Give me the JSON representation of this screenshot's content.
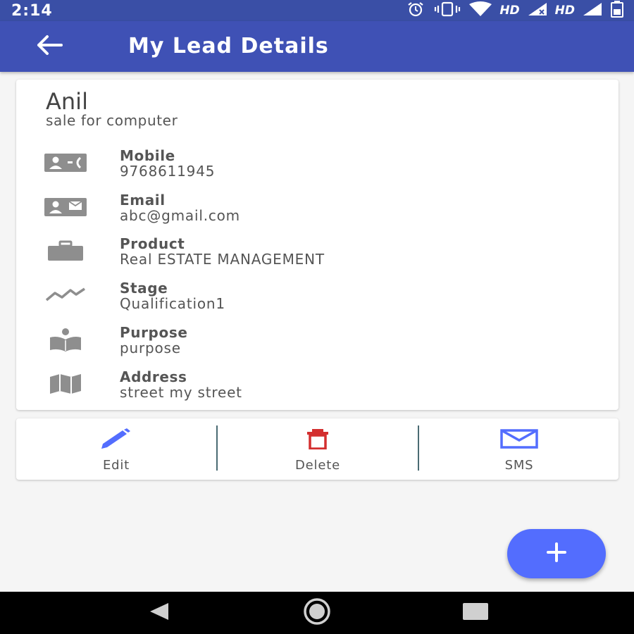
{
  "status_bar": {
    "time": "2:14",
    "network_labels": [
      "HD",
      "HD"
    ],
    "icons": [
      "alarm-icon",
      "vibrate-icon",
      "wifi-icon",
      "signal-icon",
      "signal-icon",
      "battery-icon"
    ]
  },
  "app_bar": {
    "title": "My Lead Details",
    "back_icon": "arrow-back-icon",
    "background": "#3f51b5"
  },
  "lead": {
    "name": "Anil",
    "description": "sale for computer"
  },
  "details": [
    {
      "label": "Mobile",
      "value": "9768611945",
      "icon": "contact-phone-icon"
    },
    {
      "label": "Email",
      "value": "abc@gmail.com",
      "icon": "contact-mail-icon"
    },
    {
      "label": "Product",
      "value": "Real ESTATE MANAGEMENT",
      "icon": "briefcase-icon"
    },
    {
      "label": "Stage",
      "value": "Qualification1",
      "icon": "trending-line-icon"
    },
    {
      "label": "Purpose",
      "value": "purpose",
      "icon": "open-book-person-icon"
    },
    {
      "label": "Address",
      "value": "street my street",
      "icon": "map-icon"
    }
  ],
  "actions": [
    {
      "label": "Edit",
      "icon": "pencil-icon",
      "color": "#536dfe"
    },
    {
      "label": "Delete",
      "icon": "trash-icon",
      "color": "#d32f2f"
    },
    {
      "label": "SMS",
      "icon": "envelope-icon",
      "color": "#536dfe"
    }
  ],
  "fab": {
    "icon": "plus-icon",
    "color": "#536dfe"
  },
  "nav_bar": {
    "icons": [
      "nav-back-icon",
      "nav-home-icon",
      "nav-recents-icon"
    ]
  }
}
